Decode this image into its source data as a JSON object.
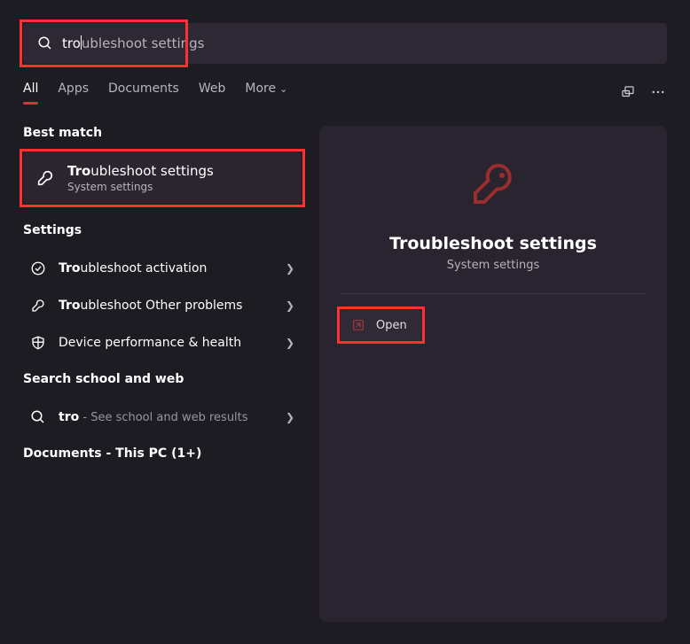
{
  "search": {
    "typed_prefix": "tro",
    "completion_suffix": "ubleshoot settings"
  },
  "tabs": {
    "items": [
      {
        "label": "All",
        "active": true,
        "has_chevron": false
      },
      {
        "label": "Apps",
        "active": false,
        "has_chevron": false
      },
      {
        "label": "Documents",
        "active": false,
        "has_chevron": false
      },
      {
        "label": "Web",
        "active": false,
        "has_chevron": false
      },
      {
        "label": "More",
        "active": false,
        "has_chevron": true
      }
    ]
  },
  "sections": {
    "best_match_header": "Best match",
    "settings_header": "Settings",
    "web_header": "Search school and web",
    "documents_header": "Documents - This PC (1+)"
  },
  "best_match": {
    "prefix": "Tro",
    "rest": "ubleshoot settings",
    "subtitle": "System settings"
  },
  "settings_results": [
    {
      "prefix": "Tro",
      "rest": "ubleshoot activation",
      "icon": "check-circle-icon"
    },
    {
      "prefix": "Tro",
      "rest": "ubleshoot Other problems",
      "icon": "wrench-icon"
    },
    {
      "prefix": "",
      "rest": "Device performance & health",
      "icon": "shield-icon"
    }
  ],
  "web_result": {
    "prefix": "tro",
    "hint_prefix": " - ",
    "hint": "See school and web results"
  },
  "detail": {
    "title": "Troubleshoot settings",
    "subtitle": "System settings",
    "open_label": "Open"
  }
}
